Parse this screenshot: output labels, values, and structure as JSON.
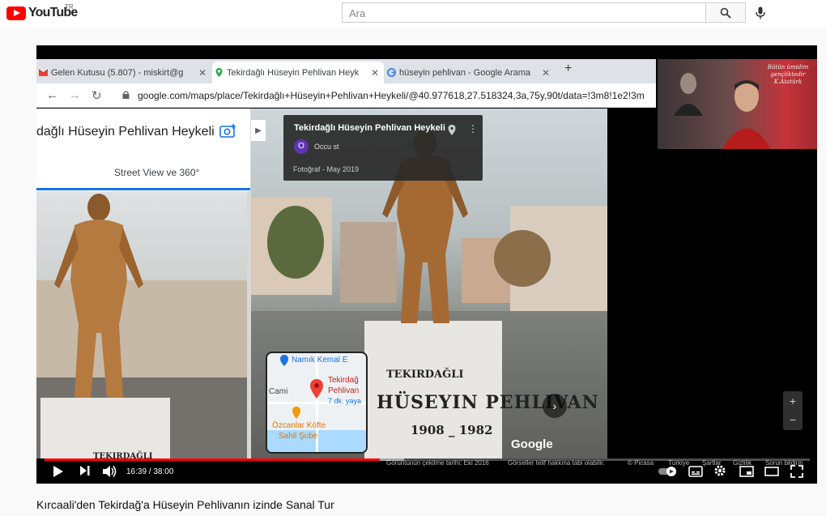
{
  "header": {
    "logo_text": "YouTube",
    "region": "TR",
    "search_placeholder": "Ara",
    "icons": [
      "youtube-logo-icon",
      "search-icon",
      "microphone-icon"
    ]
  },
  "browser": {
    "tabs": [
      {
        "label": "Gelen Kutusu (5.807) - miskirt@g",
        "icon": "gmail-icon",
        "active": false
      },
      {
        "label": "Tekirdağlı Hüseyin Pehlivan Heyk",
        "icon": "maps-pin-icon",
        "active": true
      },
      {
        "label": "hüseyin pehlivan - Google Arama",
        "icon": "google-icon",
        "active": false
      }
    ],
    "new_tab": "+",
    "url": "google.com/maps/place/Tekirdağlı+Hüseyin+Pehlivan+Heykeli/@40.977618,27.518324,3a,75y,90t/data=!3m8!1e2!3m"
  },
  "maps": {
    "panel_title": "dağlı Hüseyin Pehlivan Heykeli",
    "street_view_label": "Street View ve 360°",
    "info_card": {
      "title": "Tekirdağlı Hüseyin Pehlivan Heykeli",
      "avatar_letter": "O",
      "user": "Occu    st",
      "date": "Fotoğraf - May 2019"
    },
    "minimap": {
      "label_top": "Namık Kemal E",
      "label_place1": "Tekirdağ",
      "label_place2": "Pehlivan",
      "label_walk": "7 dk. yaya",
      "label_cami": "Cami",
      "label_restaurant1": "Özcanlar Köfte",
      "label_restaurant2": "Sahil Şube"
    },
    "pedestal_text": {
      "line1": "TEKIRDAĞLI",
      "line2": "HÜSEYIN PEHLIVAN",
      "line3": "1908 _ 1982",
      "left_fragment": "TEKIRDAĞLI"
    },
    "watermark": "Google",
    "footer": {
      "capture_date": "Görüntünün çekilme tarihi: Eki 2016",
      "copyright": "Görseller telif hakkına tabi olabilir.",
      "picasa": "© Picasa",
      "country": "Türkiye",
      "terms": "Şartlar",
      "privacy": "Gizlilik",
      "report": "Sorun bildirin"
    }
  },
  "webcam": {
    "overlay_text": "Bütün ümidim gençliktedir",
    "signature": "K.Atatürk"
  },
  "player": {
    "current_time": "16:39",
    "duration": "38:00",
    "timecode": "16:39 / 38:00",
    "progress_fraction": 0.438,
    "buffer_fraction": 0.47
  },
  "video": {
    "title": "Kırcaali'den Tekirdağ'a Hüseyin Pehlivanın izinde Sanal Tur"
  },
  "colors": {
    "youtube_red": "#ff0000",
    "maps_blue": "#1a73e8"
  }
}
